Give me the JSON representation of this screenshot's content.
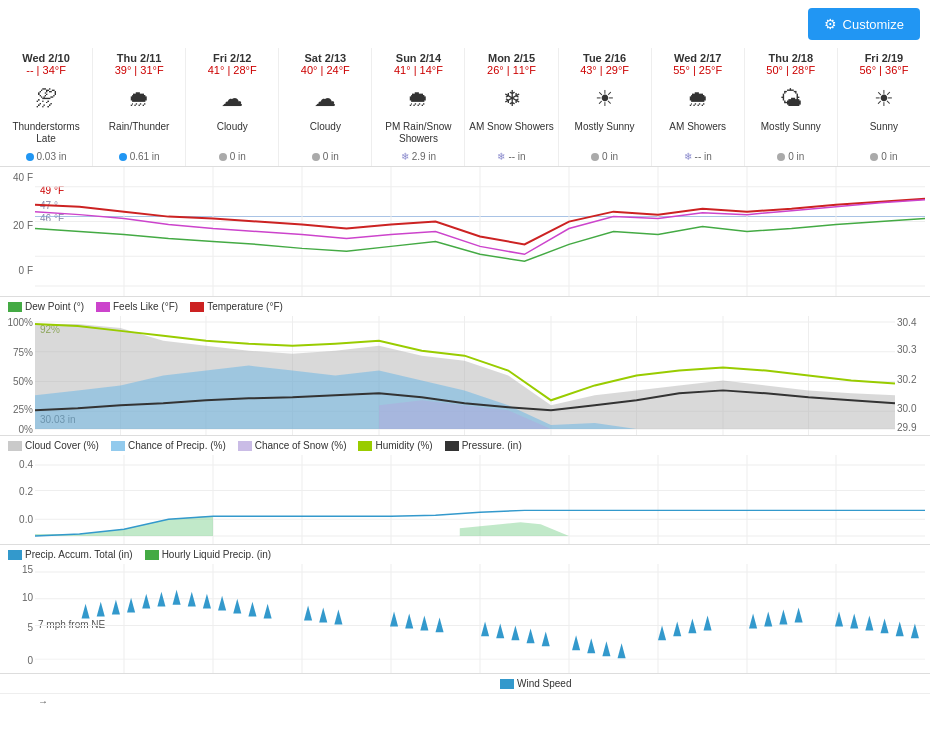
{
  "customize": {
    "label": "Customize"
  },
  "days": [
    {
      "name": "Wed 2/10",
      "temps": "-- | 34°F",
      "icon": "⛈",
      "desc": "Thunderstorms Late",
      "precip_type": "rain",
      "precip": "0.03 in"
    },
    {
      "name": "Thu 2/11",
      "temps": "39° | 31°F",
      "icon": "🌧",
      "desc": "Rain/Thunder",
      "precip_type": "rain",
      "precip": "0.61 in"
    },
    {
      "name": "Fri 2/12",
      "temps": "41° | 28°F",
      "icon": "☁",
      "desc": "Cloudy",
      "precip_type": "none",
      "precip": "0 in"
    },
    {
      "name": "Sat 2/13",
      "temps": "40° | 24°F",
      "icon": "☁",
      "desc": "Cloudy",
      "precip_type": "none",
      "precip": "0 in"
    },
    {
      "name": "Sun 2/14",
      "temps": "41° | 14°F",
      "icon": "🌧",
      "desc": "PM Rain/Snow Showers",
      "precip_type": "snow",
      "precip": "2.9 in"
    },
    {
      "name": "Mon 2/15",
      "temps": "26° | 11°F",
      "icon": "❄",
      "desc": "AM Snow Showers",
      "precip_type": "snow",
      "precip": "-- in"
    },
    {
      "name": "Tue 2/16",
      "temps": "43° | 29°F",
      "icon": "☀",
      "desc": "Mostly Sunny",
      "precip_type": "none",
      "precip": "0 in"
    },
    {
      "name": "Wed 2/17",
      "temps": "55° | 25°F",
      "icon": "🌧",
      "desc": "AM Showers",
      "precip_type": "snow",
      "precip": "-- in"
    },
    {
      "name": "Thu 2/18",
      "temps": "50° | 28°F",
      "icon": "🌤",
      "desc": "Mostly Sunny",
      "precip_type": "none",
      "precip": "0 in"
    },
    {
      "name": "Fri 2/19",
      "temps": "56° | 36°F",
      "icon": "☀",
      "desc": "Sunny",
      "precip_type": "none",
      "precip": "0 in"
    }
  ],
  "temp_legend": {
    "dew_point": "Dew Point (°)",
    "feels_like": "Feels Like (°F)",
    "temperature": "Temperature (°F)"
  },
  "pct_legend": {
    "cloud_cover": "Cloud Cover (%)",
    "chance_precip": "Chance of Precip. (%)",
    "chance_snow": "Chance of Snow (%)",
    "humidity": "Humidity (%)",
    "pressure": "Pressure. (in)"
  },
  "precip_legend": {
    "accum": "Precip. Accum. Total (in)",
    "hourly": "Hourly Liquid Precip. (in)"
  },
  "wind_legend": {
    "speed": "Wind Speed"
  },
  "chart_labels": {
    "temp_49": "49 °F",
    "temp_47": "47 °",
    "temp_46": "46 °F",
    "pct_92": "92%",
    "pressure_3003": "30.03 in",
    "pressure_right_top": "30.4",
    "pressure_right_2": "30.3",
    "pressure_right_3": "30.2",
    "pressure_right_4": "30.0",
    "pressure_right_bot": "29.9",
    "wind_note": "7 mph from NE",
    "arrow_label": "→"
  }
}
